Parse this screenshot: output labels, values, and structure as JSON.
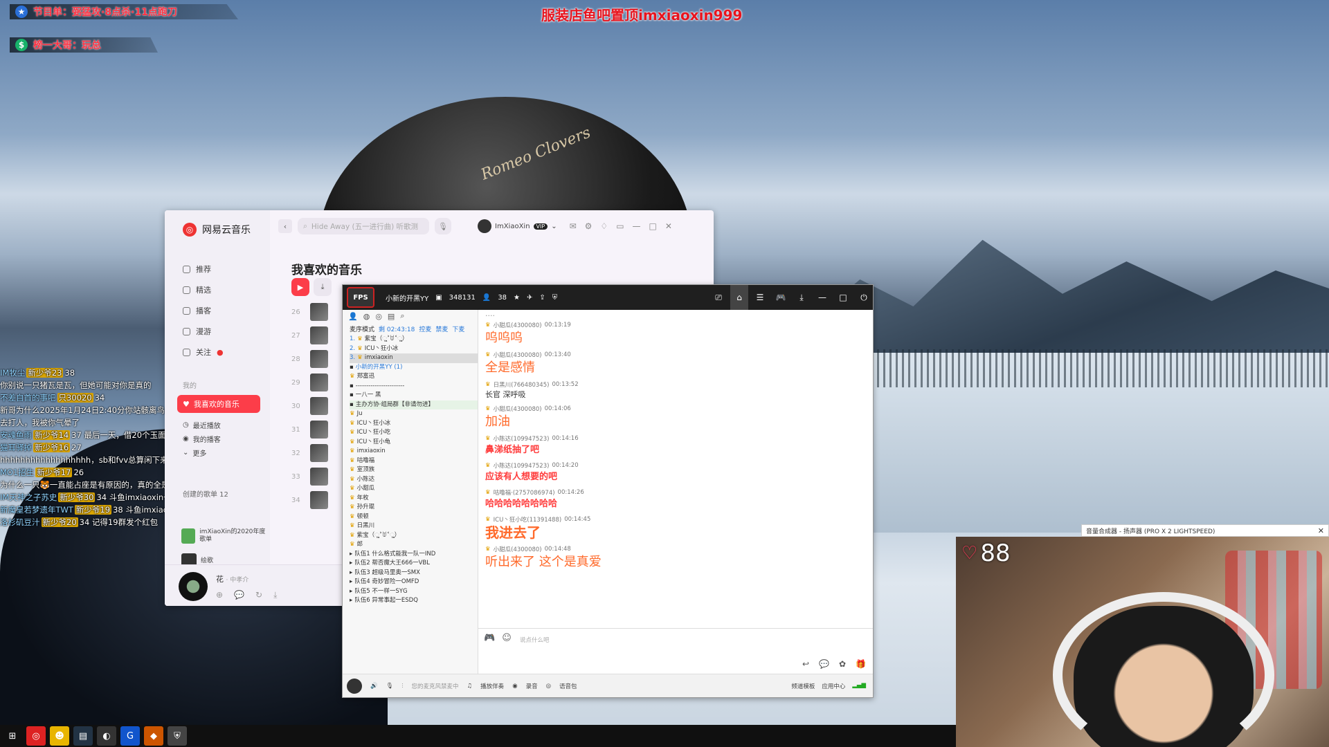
{
  "overlay": {
    "banner1_label": "节目单：弼猛攻·8点杀·11点跑刀",
    "banner2_label": "榜一大哥：玩总",
    "top_title": "服装店鱼吧置顶imxiaoxin999",
    "danmu": [
      {
        "name": "IM牧尘",
        "badge": "新少爷23",
        "level": "38",
        "text": ""
      },
      {
        "name": "",
        "badge": "",
        "level": "",
        "text": "你别说一只猪瓦是瓦，但她可能对你是真的"
      },
      {
        "name": "不差自首的事吧",
        "badge": "只30020",
        "level": "34",
        "text": ""
      },
      {
        "name": "",
        "badge": "",
        "level": "",
        "text": "新哥为什么2025年1月24日2:40分你站骸离鸟最后三秒600w要走出"
      },
      {
        "name": "",
        "badge": "",
        "level": "",
        "text": "去打人，我被你气晕了"
      },
      {
        "name": "安魂鱼雨",
        "badge": "新少爷14",
        "level": "37",
        "text": "最后一天，借20个玉面貌下赌博可以吗"
      },
      {
        "name": "猫耳驿掉",
        "badge": "新少爷16",
        "level": "27",
        "text": ""
      },
      {
        "name": "",
        "badge": "",
        "level": "",
        "text": "hhhhhhhhhhhhhhhhhh，sb和fvv总算闲下来了"
      },
      {
        "name": "MO1招生",
        "badge": "新少爷17",
        "level": "26",
        "text": ""
      },
      {
        "name": "",
        "badge": "",
        "level": "",
        "text": "为什么一只🐯一直能占座是有原因的，真的全是GTM"
      },
      {
        "name": "IM天神之子苏史",
        "badge": "新少爷30",
        "level": "34",
        "text": "斗鱼imxiaoxin一新用户"
      },
      {
        "name": "新魔皇若梦遗年TWT",
        "badge": "新少爷19",
        "level": "38",
        "text": "斗鱼imxiaoxin一新用户"
      },
      {
        "name": "洛杉矶豆汁",
        "badge": "新少爷20",
        "level": "34",
        "text": "记得19群发个红包"
      }
    ]
  },
  "netease": {
    "app_name": "网易云音乐",
    "search_placeholder": "Hide Away (五一进行曲) 听歌测",
    "user_name": "ImXiaoXin",
    "vip": "VIP",
    "nav": [
      "推荐",
      "精选",
      "播客",
      "漫游",
      "关注"
    ],
    "mine_label": "我的",
    "fav_label": "我喜欢的音乐",
    "nav2": [
      "最近播放",
      "我的播客",
      "更多"
    ],
    "created_label": "创建的歌单 12",
    "playlist_title": "imXiaoXin的2020年度歌单",
    "playlist2": "绘歌",
    "page_title": "我喜欢的音乐",
    "rows": [
      "26",
      "27",
      "28",
      "29",
      "30",
      "31",
      "32",
      "33",
      "34"
    ],
    "now_playing": "花",
    "now_playing_artist": "· 中孝介"
  },
  "yy": {
    "channel": "小新的开黑YY",
    "id": "348131",
    "online": "38",
    "mode": "麦序模式",
    "timer": "剩 02:43:18",
    "actions": [
      "控麦",
      "禁麦",
      "下麦"
    ],
    "mic_list": [
      {
        "n": "1.",
        "name": "紫宝（ૢ˃ꌂ˂ૢ）",
        "hl": false
      },
      {
        "n": "2.",
        "name": "ICU丶狂小冰",
        "hl": false
      },
      {
        "n": "3.",
        "name": "imxiaoxin",
        "hl": true
      }
    ],
    "channel_group": "小新的开黑YY (1)",
    "owner": "郑富迅",
    "sub_channels": [
      "-----------------------",
      "一八一 黑",
      "主办方协·组局群【非请勿进】"
    ],
    "members": [
      "Ju",
      "ICU丶狂小冰",
      "ICU丶狂小吃",
      "ICU丶狂小龟",
      "imxiaoxin",
      "咕噜福",
      "室顶族",
      "小陈达",
      "小甜瓜",
      "年枚",
      "孙升琨",
      "顿顿",
      "日黑川",
      "紫宝（ૢ˃ꌂ˂ૢ）",
      "郎"
    ],
    "teams": [
      "队伍1 什么格式能我一队一IND",
      "队伍2 帮否魔大王666一VBL",
      "队伍3 超级马里奥一SMX",
      "队伍4 奇妙冒险一OMFD",
      "队伍5 不一样一SYG",
      "队伍6 异常事起一ESDQ"
    ],
    "messages": [
      {
        "user": "小甜瓜(4300080)",
        "time": "00:13:19",
        "text": "呜呜呜",
        "style": ""
      },
      {
        "user": "小甜瓜(4300080)",
        "time": "00:13:40",
        "text": "全是感情",
        "style": ""
      },
      {
        "user": "日黑川(766480345)",
        "time": "00:13:52",
        "text": "长官 深呼吸",
        "style": "small"
      },
      {
        "user": "小甜瓜(4300080)",
        "time": "00:14:06",
        "text": "加油",
        "style": ""
      },
      {
        "user": "小陈达(109947523)",
        "time": "00:14:16",
        "text": "鼻涕纸抽了吧",
        "style": "pink"
      },
      {
        "user": "小陈达(109947523)",
        "time": "00:14:20",
        "text": "应该有人想要的吧",
        "style": "pink"
      },
      {
        "user": "咕噜福·(2757086974)",
        "time": "00:14:26",
        "text": "哈哈哈哈哈哈哈哈",
        "style": "pink"
      },
      {
        "user": "ICU丶狂小吃(11391488)",
        "time": "00:14:45",
        "text": "我进去了",
        "style": "big"
      },
      {
        "user": "小甜瓜(4300080)",
        "time": "00:14:48",
        "text": "听出来了  这个是真爱",
        "style": ""
      }
    ],
    "input_placeholder": "说点什么吧",
    "bottom": [
      "您的麦克风禁麦中",
      "播放伴奏",
      "录音",
      "语音包"
    ],
    "bottom_right": [
      "频道模板",
      "应用中心"
    ]
  },
  "cam": {
    "window_title": "音量合成器 - 扬声器 (PRO X 2 LIGHTSPEED)",
    "heart_count": "88"
  }
}
